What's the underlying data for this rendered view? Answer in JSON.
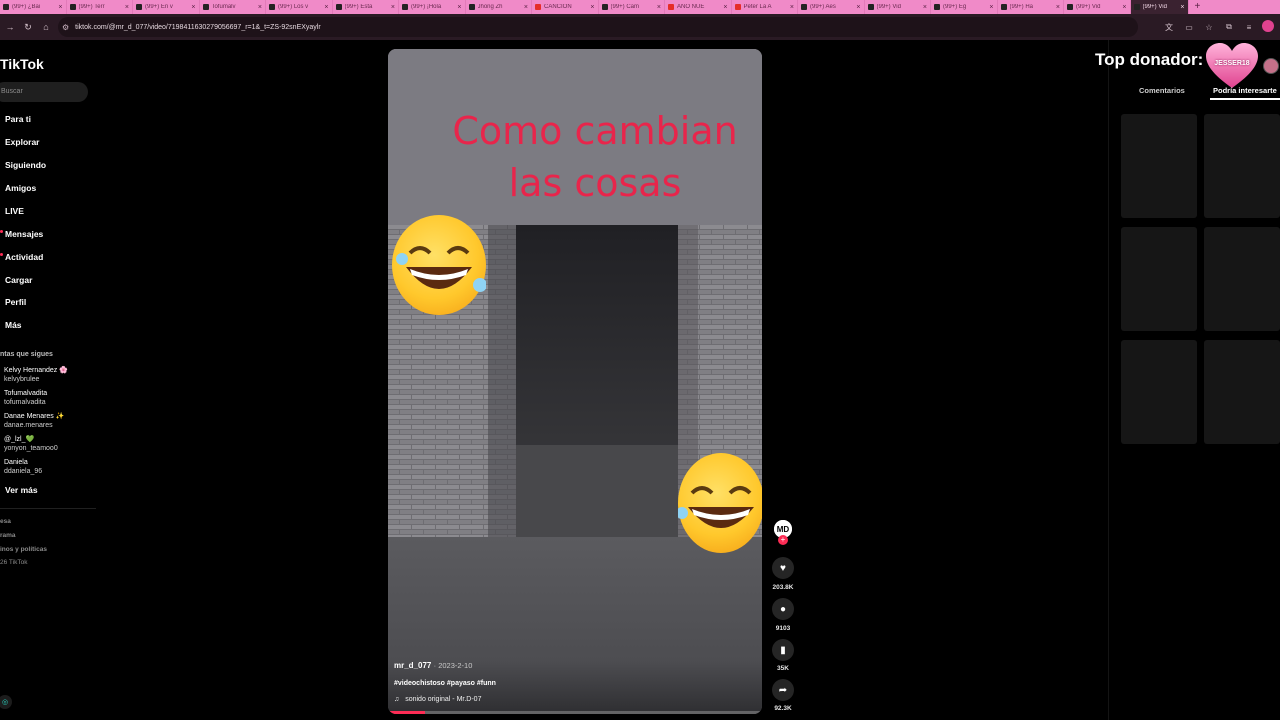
{
  "browser": {
    "tabs": [
      {
        "title": "(99+) ¿Bai",
        "icon": "tiktok-icon"
      },
      {
        "title": "(99+) Terr",
        "icon": "tiktok-icon"
      },
      {
        "title": "(99+) En v",
        "icon": "tiktok-icon"
      },
      {
        "title": "Tofumalv",
        "icon": "tiktok-icon"
      },
      {
        "title": "(99+) Los v",
        "icon": "tiktok-icon"
      },
      {
        "title": "(99+) Esta",
        "icon": "tiktok-icon"
      },
      {
        "title": "(99+) ¡Hola",
        "icon": "tiktok-icon"
      },
      {
        "title": "Jhong Zh",
        "icon": "tiktok-icon"
      },
      {
        "title": "CANCIÓN",
        "icon": "youtube-icon"
      },
      {
        "title": "(99+) Cam",
        "icon": "tiktok-icon"
      },
      {
        "title": "AÑO NUE",
        "icon": "youtube-icon"
      },
      {
        "title": "Peter La A",
        "icon": "youtube-icon"
      },
      {
        "title": "(99+) Aes",
        "icon": "tiktok-icon"
      },
      {
        "title": "(99+) Vid",
        "icon": "tiktok-icon"
      },
      {
        "title": "(99+) Eg",
        "icon": "tiktok-icon"
      },
      {
        "title": "(99+) Ha",
        "icon": "tiktok-icon"
      },
      {
        "title": "(99+) Vid",
        "icon": "tiktok-icon"
      }
    ],
    "active_tab": {
      "title": "(99+) Vid",
      "icon": "tiktok-icon"
    },
    "url": "tiktok.com/@mr_d_077/video/7198411630279056697_r=1&_t=ZS-92snEXyaylr"
  },
  "sidebar": {
    "logo": "TikTok",
    "search_placeholder": "Buscar",
    "nav": [
      "Para ti",
      "Explorar",
      "Siguiendo",
      "Amigos",
      "LIVE",
      "Mensajes",
      "Actividad",
      "Cargar",
      "Perfil",
      "Más"
    ],
    "following_title": "ntas que sigues",
    "accounts": [
      {
        "name": "Kelvy Hernandez 🌸",
        "handle": "kelvybrulee"
      },
      {
        "name": "Tofumalvadita",
        "handle": "tofumalvadita"
      },
      {
        "name": "Danae Menares ✨",
        "handle": "danae.menares"
      },
      {
        "name": "@_lzl_💚",
        "handle": "yonyon_teamoo0"
      },
      {
        "name": "Daniela",
        "handle": "ddaniela_96"
      }
    ],
    "see_more": "Ver más",
    "footer": [
      "esa",
      "rama",
      "inos y políticas",
      "26 TikTok"
    ]
  },
  "video": {
    "overlay_text": [
      "Como cambian",
      "las cosas"
    ],
    "author": "mr_d_077",
    "date": "2023-2-10",
    "hashtags": "#videochistoso #payaso #funn",
    "sound": "sonido original - Mr.D-07",
    "progress": 0.1
  },
  "actions": {
    "likes": "203.8K",
    "comments": "9103",
    "saves": "35K",
    "shares": "92.3K"
  },
  "right_panel": {
    "donor_title": "Top donador:",
    "donor_name": "JESSER18",
    "tabs": [
      "Comentarios",
      "Podría interesarte"
    ]
  },
  "colors": {
    "brand": "#fe2c55",
    "overlay_text": "#e8254b",
    "tab_strip": "#f08ac8"
  }
}
